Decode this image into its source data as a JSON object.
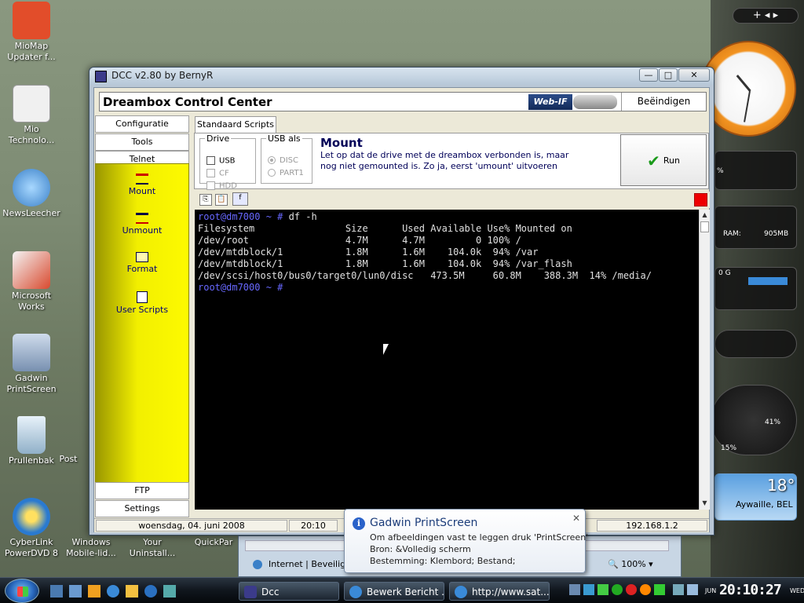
{
  "desktop_icons": [
    {
      "label": "MioMap Updater f...",
      "color": "#e24d2a"
    },
    {
      "label": "Mio Technolo...",
      "color": "#f0f0f0"
    },
    {
      "label": "NewsLeecher",
      "color": "#6fb0e8"
    },
    {
      "label": "Microsoft Works",
      "color": "#d94a2f"
    },
    {
      "label": "Gadwin PrintScreen",
      "color": "#9ab0cc"
    },
    {
      "label": "Prullenbak",
      "color": "#a8c8e0"
    },
    {
      "label": "CyberLink PowerDVD 8",
      "color": "#2a7ad0"
    }
  ],
  "desktop_bottom": {
    "windows_mobile": "Windows Mobile-lid...",
    "your_uninstall": "Your Uninstall...",
    "quickpar": "QuickPar",
    "post": "Post"
  },
  "window": {
    "title": "DCC v2.80 by BernyR",
    "app_title": "Dreambox Control Center",
    "webif_label": "Web-IF",
    "beeindigen": "Beëindigen",
    "minimize": "—",
    "maximize": "□",
    "close": "✕"
  },
  "nav": {
    "configuratie": "Configuratie",
    "tools": "Tools",
    "telnet": "Telnet",
    "ftp": "FTP",
    "settings": "Settings",
    "items": [
      {
        "label": "Mount",
        "icon": "mount-icon"
      },
      {
        "label": "Unmount",
        "icon": "unmount-icon"
      },
      {
        "label": "Format",
        "icon": "format-icon"
      },
      {
        "label": "User Scripts",
        "icon": "user-scripts-icon"
      }
    ]
  },
  "tab": {
    "label": "Standaard Scripts"
  },
  "drive": {
    "legend": "Drive",
    "options": [
      "USB",
      "CF",
      "HDD"
    ]
  },
  "usb_als": {
    "legend": "USB als",
    "options": [
      "DISC",
      "PART1"
    ]
  },
  "script": {
    "title": "Mount",
    "description": "Let op dat de drive met de dreambox verbonden is, maar nog niet gemounted is. Zo ja, eerst 'umount' uitvoeren",
    "run_label": "Run"
  },
  "terminal": {
    "prompt": "root@dm7000 ~ #",
    "command": "df -h",
    "header": "Filesystem                Size      Used Available Use% Mounted on",
    "rows": [
      "/dev/root                 4.7M      4.7M         0 100% /",
      "/dev/mtdblock/1           1.8M      1.6M    104.0k  94% /var",
      "/dev/mtdblock/1           1.8M      1.6M    104.0k  94% /var_flash",
      "/dev/scsi/host0/bus0/target0/lun0/disc   473.5M     60.8M    388.3M  14% /media/"
    ]
  },
  "status": {
    "date": "woensdag, 04. juni 2008",
    "time": "20:10",
    "ip": "192.168.1.2"
  },
  "ie": {
    "status": "Internet | Beveiligd",
    "zoom": "100%"
  },
  "balloon": {
    "title": "Gadwin PrintScreen",
    "line1": "Om afbeeldingen vast te leggen druk 'PrintScreen'",
    "line2": "Bron:  &Volledig scherm",
    "line3": "Bestemming:  Klembord; Bestand;"
  },
  "gadgets": {
    "ram_label": "RAM:",
    "ram_value": "905MB",
    "cpu_label": "15%",
    "mem_label": "41%",
    "temperature": "18°",
    "location": "Aywaille, BEL",
    "disk_label": "0 G",
    "percent_sign": "%"
  },
  "taskbar": {
    "items": [
      "Dcc",
      "Bewerk Bericht ...",
      "http://www.sat..."
    ],
    "clock": "20:10:27",
    "clock_day": "WED",
    "clock_month": "JUN"
  },
  "colors": {
    "nav_yellow": "#f2ef00",
    "prompt_blue": "#6868ff",
    "run_green": "#1a9a1a"
  }
}
